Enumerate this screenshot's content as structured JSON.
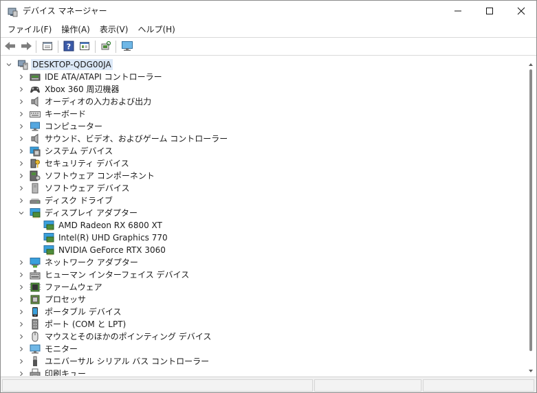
{
  "window": {
    "title": "デバイス マネージャー"
  },
  "menu": [
    "ファイル(F)",
    "操作(A)",
    "表示(V)",
    "ヘルプ(H)"
  ],
  "toolbar_icons": [
    "back-arrow-icon",
    "forward-arrow-icon",
    "properties-icon",
    "help-icon",
    "view-icon",
    "scan-hardware-icon",
    "monitor-icon"
  ],
  "tree": {
    "root": "DESKTOP-QDG00JA",
    "items": [
      {
        "label": "IDE ATA/ATAPI コントローラー",
        "icon": "ide-controller-icon",
        "expanded": false
      },
      {
        "label": "Xbox 360 周辺機器",
        "icon": "gamepad-icon",
        "expanded": false
      },
      {
        "label": "オーディオの入力および出力",
        "icon": "speaker-icon",
        "expanded": false
      },
      {
        "label": "キーボード",
        "icon": "keyboard-icon",
        "expanded": false
      },
      {
        "label": "コンピューター",
        "icon": "computer-icon",
        "expanded": false
      },
      {
        "label": "サウンド、ビデオ、およびゲーム コントローラー",
        "icon": "speaker-icon",
        "expanded": false
      },
      {
        "label": "システム デバイス",
        "icon": "system-device-icon",
        "expanded": false
      },
      {
        "label": "セキュリティ デバイス",
        "icon": "security-key-icon",
        "expanded": false
      },
      {
        "label": "ソフトウェア コンポーネント",
        "icon": "software-component-icon",
        "expanded": false
      },
      {
        "label": "ソフトウェア デバイス",
        "icon": "software-device-icon",
        "expanded": false
      },
      {
        "label": "ディスク ドライブ",
        "icon": "disk-drive-icon",
        "expanded": false
      },
      {
        "label": "ディスプレイ アダプター",
        "icon": "display-adapter-icon",
        "expanded": true,
        "children": [
          {
            "label": "AMD Radeon RX 6800 XT",
            "icon": "display-adapter-icon"
          },
          {
            "label": "Intel(R) UHD Graphics 770",
            "icon": "display-adapter-icon"
          },
          {
            "label": "NVIDIA GeForce RTX 3060",
            "icon": "display-adapter-icon"
          }
        ]
      },
      {
        "label": "ネットワーク アダプター",
        "icon": "network-adapter-icon",
        "expanded": false
      },
      {
        "label": "ヒューマン インターフェイス デバイス",
        "icon": "hid-icon",
        "expanded": false
      },
      {
        "label": "ファームウェア",
        "icon": "firmware-icon",
        "expanded": false
      },
      {
        "label": "プロセッサ",
        "icon": "processor-icon",
        "expanded": false
      },
      {
        "label": "ポータブル デバイス",
        "icon": "portable-device-icon",
        "expanded": false
      },
      {
        "label": "ポート (COM と LPT)",
        "icon": "port-icon",
        "expanded": false
      },
      {
        "label": "マウスとそのほかのポインティング デバイス",
        "icon": "mouse-icon",
        "expanded": false
      },
      {
        "label": "モニター",
        "icon": "monitor-icon",
        "expanded": false
      },
      {
        "label": "ユニバーサル シリアル バス コントローラー",
        "icon": "usb-icon",
        "expanded": false
      },
      {
        "label": "印刷キュー",
        "icon": "printer-icon",
        "expanded": false
      }
    ]
  },
  "colors": {
    "selection": "#dbe8f7",
    "monitor_blue": "#3aa0dc",
    "chip_green": "#4e8d3a"
  }
}
